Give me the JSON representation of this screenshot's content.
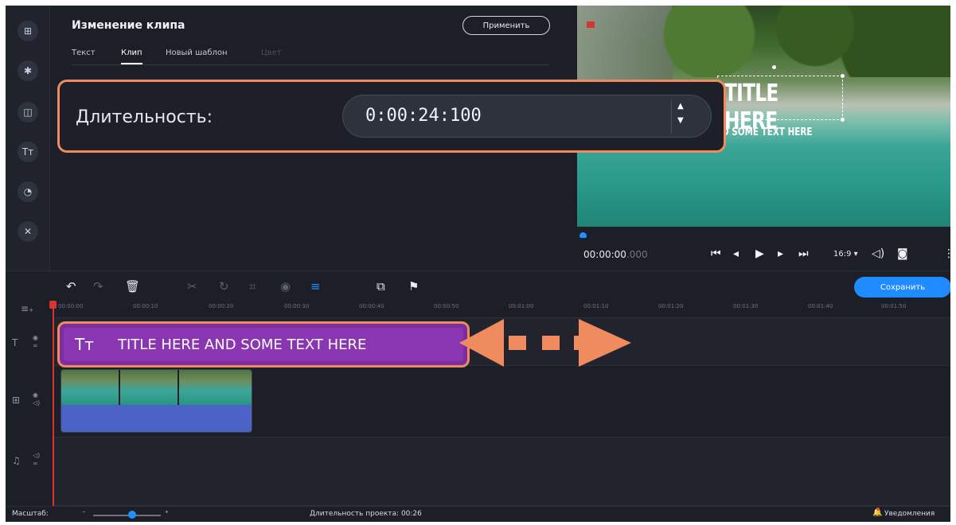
{
  "panel": {
    "title": "Изменение клипа",
    "apply_label": "Применить",
    "tabs": [
      {
        "label": "Текст",
        "state": "normal"
      },
      {
        "label": "Клип",
        "state": "active"
      },
      {
        "label": "Новый шаблон",
        "state": "normal"
      },
      {
        "label": "Цвет",
        "state": "disabled"
      }
    ]
  },
  "duration": {
    "label": "Длительность:",
    "value": "0:00:24:100"
  },
  "preview": {
    "title_text": "TITLE HERE",
    "subtitle_text": "D SOME TEXT HERE",
    "timecode_main": "00:00:00",
    "timecode_ms": ".000",
    "aspect_ratio": "16:9"
  },
  "toolbar": {
    "save_label": "Сохранить"
  },
  "ruler": {
    "ticks": [
      "00:00:00",
      "00:00:10",
      "00:00:20",
      "00:00:30",
      "00:00:40",
      "00:00:50",
      "00:01:00",
      "00:01:10",
      "00:01:20",
      "00:01:30",
      "00:01:40",
      "00:01:50"
    ]
  },
  "clips": {
    "title_clip_icon": "Tт",
    "title_clip_text": "TITLE HERE AND SOME TEXT HERE"
  },
  "status": {
    "zoom_label": "Масштаб:",
    "project_duration": "Длительность проекта: 00:26",
    "notifications": "Уведомления"
  },
  "colors": {
    "accent": "#1e90ff",
    "callout": "#ef8b5e",
    "title_clip": "#8a36b3",
    "audio_band": "#4b62c7"
  },
  "icons": [
    "import-icon",
    "magic-icon",
    "transitions-icon",
    "titles-icon",
    "stickers-icon",
    "tools-icon",
    "undo-icon",
    "redo-icon",
    "delete-icon",
    "cut-icon",
    "rotate-icon",
    "crop-icon",
    "color-icon",
    "clip-properties-icon",
    "overlay-icon",
    "marker-icon",
    "snapshot-icon",
    "volume-icon",
    "bell-icon"
  ]
}
